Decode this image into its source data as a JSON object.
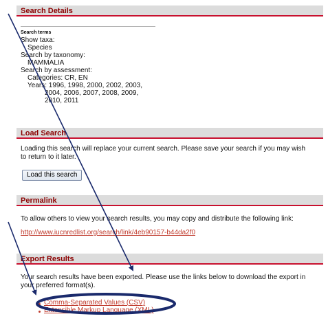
{
  "search_details": {
    "header": "Search Details",
    "search_terms_label": "Search terms",
    "lines": [
      "Show taxa:",
      "Species",
      "Search by taxonomy:",
      "MAMMALIA",
      "Search by assessment:",
      "Categories: CR, EN",
      "Years: 1996, 1998, 2000, 2002, 2003,",
      "2004, 2006, 2007, 2008, 2009,",
      "2010, 2011"
    ]
  },
  "load_search": {
    "header": "Load Search",
    "description_1": "Loading this search will replace your current search. Please save your search if you may wish",
    "description_2": "to return to it later.",
    "button_label": "Load this search"
  },
  "permalink": {
    "header": "Permalink",
    "description": "To allow others to view your search results, you may copy and distribute the following link:",
    "url": "http://www.iucnredlist.org/search/link/4eb90157-b44da2f0"
  },
  "export_results": {
    "header": "Export Results",
    "description_1": "Your search results have been exported. Please use the links below to download the export in",
    "description_2": "your preferred format(s).",
    "links": [
      "Comma-Separated Values (CSV)",
      "Extensible Markup Language (XML)"
    ]
  },
  "colors": {
    "header_text": "#8b0000",
    "header_rule": "#c8102e",
    "link": "#c0392b",
    "annotation": "#1a2a6c"
  }
}
